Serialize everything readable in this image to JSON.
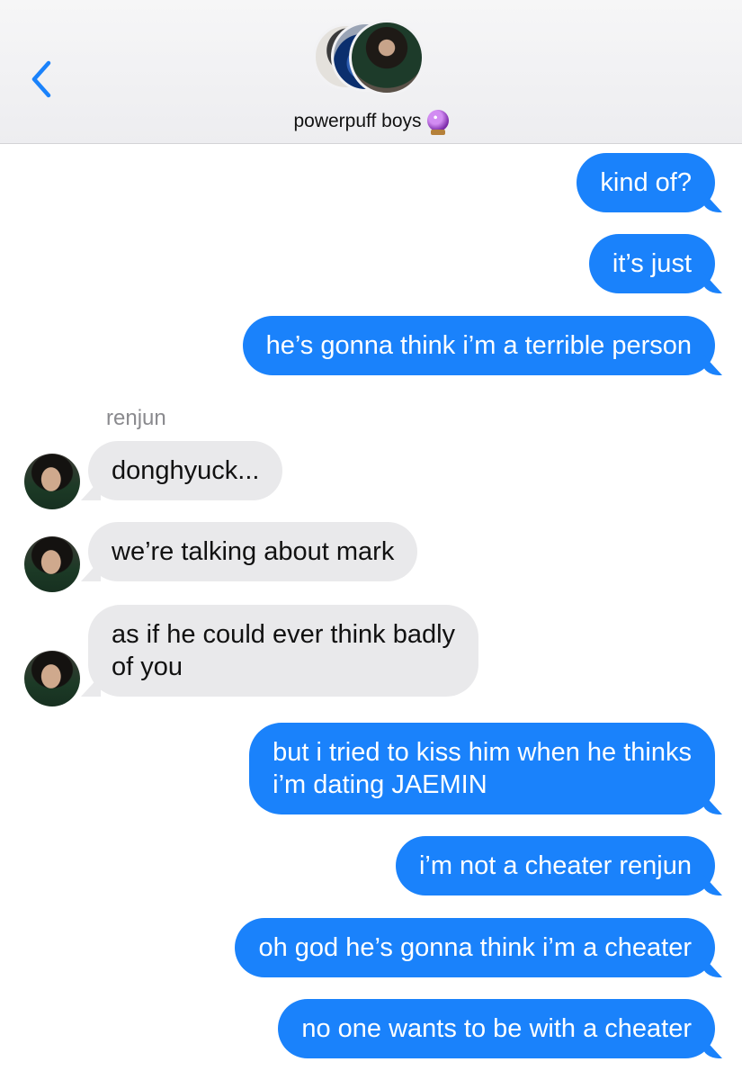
{
  "header": {
    "back_label": "<",
    "group_name": "powerpuff boys",
    "group_emoji": "crystal-ball",
    "icons": [
      "chevron-left-icon",
      "group-avatar-icon"
    ]
  },
  "conversation": {
    "sender_name": "renjun",
    "messages": [
      {
        "from": "me",
        "text": "kind of?"
      },
      {
        "from": "me",
        "text": "it’s just"
      },
      {
        "from": "me",
        "text": "he’s gonna think i’m a terrible person"
      },
      {
        "from": "renjun",
        "text": "donghyuck..."
      },
      {
        "from": "renjun",
        "text": "we’re talking about mark"
      },
      {
        "from": "renjun",
        "text_lines": [
          "as if he could ever think badly",
          "of you"
        ]
      },
      {
        "from": "me",
        "text_lines": [
          "but i tried to kiss him when he thinks",
          "i’m dating JAEMIN"
        ]
      },
      {
        "from": "me",
        "text": "i’m not a cheater renjun"
      },
      {
        "from": "me",
        "text": "oh god he’s gonna think i’m a cheater"
      },
      {
        "from": "me",
        "text": "no one wants to be with a cheater"
      }
    ]
  },
  "colors": {
    "outgoing_bubble": "#1a82fb",
    "incoming_bubble": "#e9e9eb",
    "accent": "#1a82fb"
  }
}
